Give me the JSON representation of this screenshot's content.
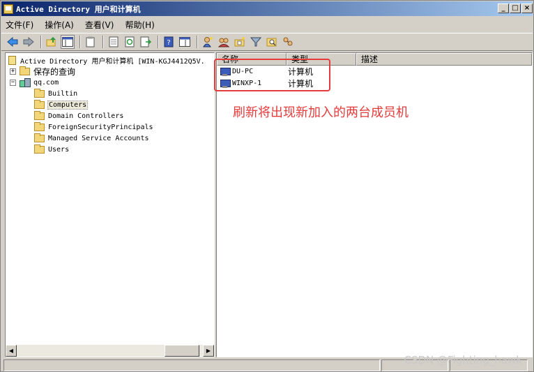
{
  "window": {
    "title": "Active Directory 用户和计算机"
  },
  "menu": [
    "文件(F)",
    "操作(A)",
    "查看(V)",
    "帮助(H)"
  ],
  "toolbar": {
    "icons": [
      "back-icon",
      "forward-icon",
      "up-icon",
      "show-console-tree-icon",
      "copy-icon",
      "properties-icon",
      "refresh-icon",
      "export-list-icon",
      "help-icon",
      "mmc-icon",
      "new-user-icon",
      "new-group-icon",
      "new-ou-icon",
      "filter-icon",
      "find-icon",
      "delegate-icon"
    ]
  },
  "tree": {
    "root": "Active Directory 用户和计算机 [WIN-KGJ4412Q5V.",
    "saved_queries": "保存的查询",
    "domain": "qq.com",
    "children": [
      "Builtin",
      "Computers",
      "Domain Controllers",
      "ForeignSecurityPrincipals",
      "Managed Service Accounts",
      "Users"
    ],
    "selected": "Computers"
  },
  "list": {
    "columns": [
      "名称",
      "类型",
      "描述"
    ],
    "rows": [
      {
        "name": "DU-PC",
        "type": "计算机",
        "description": ""
      },
      {
        "name": "WINXP-1",
        "type": "计算机",
        "description": ""
      }
    ]
  },
  "annotation": "刷新将出现新加入的两台成员机",
  "colors": {
    "annotation": "#e53b3b",
    "titlebar_start": "#0a246a",
    "titlebar_end": "#a6caf0"
  },
  "watermark": "CSDN @Fighting_hawk"
}
